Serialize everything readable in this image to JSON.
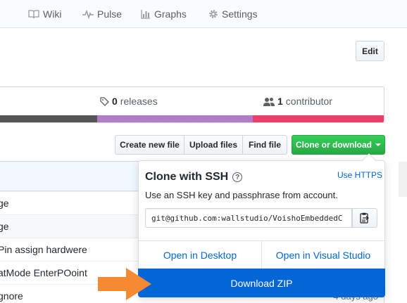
{
  "nav": {
    "tabs": [
      {
        "label": "Wiki",
        "icon": "book-icon"
      },
      {
        "label": "Pulse",
        "icon": "pulse-icon"
      },
      {
        "label": "Graphs",
        "icon": "graph-icon"
      },
      {
        "label": "Settings",
        "icon": "gear-icon"
      }
    ]
  },
  "repo": {
    "edit_label": "Edit",
    "releases_count": "0",
    "releases_label": "releases",
    "contributors_count": "1",
    "contributors_label": "contributor",
    "language_colors": [
      "#555555",
      "#b07cc6",
      "#e83e6c"
    ]
  },
  "actions": {
    "create_new_file": "Create new file",
    "upload_files": "Upload files",
    "find_file": "Find file",
    "clone_or_download": "Clone or download"
  },
  "files": [
    {
      "name": "ge",
      "age": ""
    },
    {
      "name": "ge",
      "age": ""
    },
    {
      "name": "Pin assign hardwere",
      "age": ""
    },
    {
      "name": "atMode EnterPOoint",
      "age": ""
    },
    {
      "name": "gnore",
      "age": "4 days ago"
    }
  ],
  "clone_popover": {
    "title": "Clone with SSH",
    "use_https": "Use HTTPS",
    "description": "Use an SSH key and passphrase from account.",
    "clone_url": "git@github.com:wallstudio/VoishoEmbeddedC",
    "open_desktop": "Open in Desktop",
    "open_visual_studio": "Open in Visual Studio",
    "download_zip": "Download ZIP"
  },
  "colors": {
    "accent_blue": "#0366d6",
    "green": "#28a745",
    "annotation_arrow": "#f58a33"
  }
}
